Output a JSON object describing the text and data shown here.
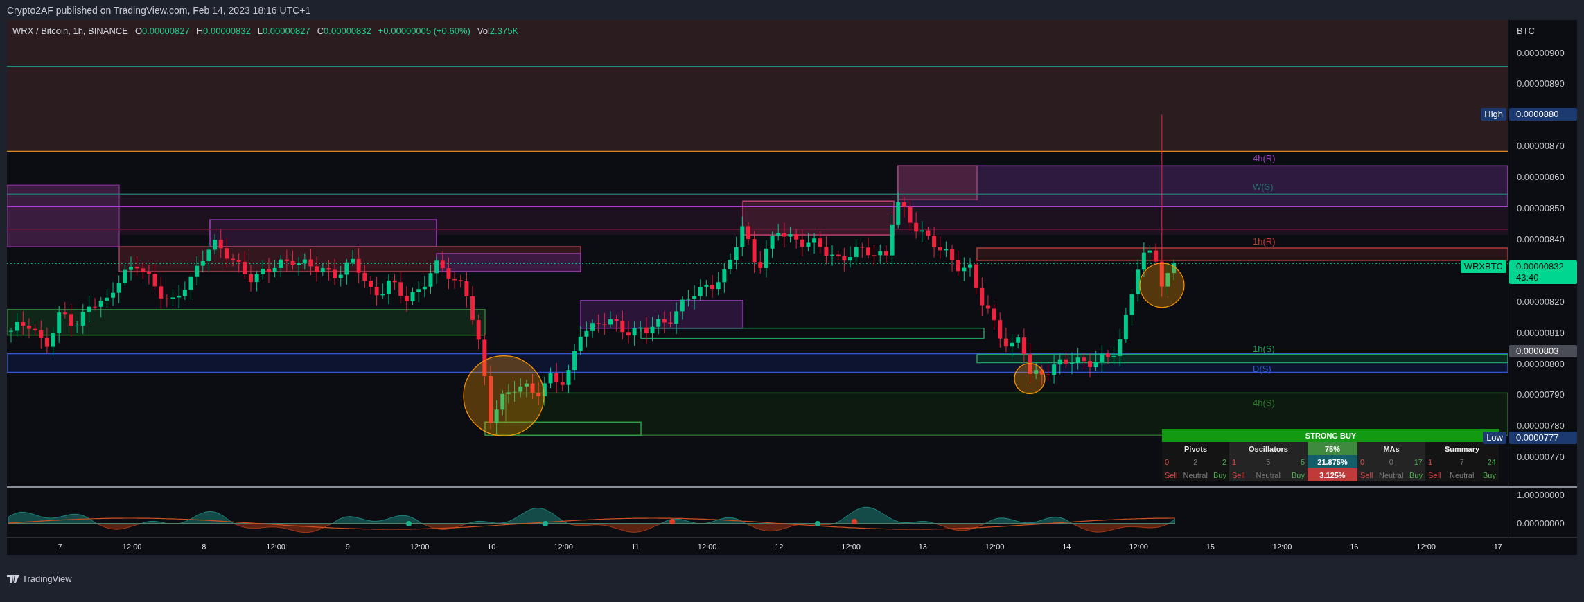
{
  "attribution": "Crypto2AF published on TradingView.com, Feb 14, 2023 18:16 UTC+1",
  "legend": {
    "symbol": "WRX / Bitcoin, 1h, BINANCE",
    "fields": [
      {
        "label": "O",
        "value": "0.00000827"
      },
      {
        "label": "H",
        "value": "0.00000832"
      },
      {
        "label": "L",
        "value": "0.00000827"
      },
      {
        "label": "C",
        "value": "0.00000832"
      }
    ],
    "change": "+0.00000005 (+0.60%)",
    "volume_label": "Vol",
    "volume": "2.375K"
  },
  "price_axis": {
    "currency": "BTC",
    "ticks": [
      "0.00000900",
      "0.00000890",
      "0.00000870",
      "0.00000860",
      "0.00000850",
      "0.00000840",
      "0.00000820",
      "0.00000810",
      "0.00000800",
      "0.00000790",
      "0.00000780",
      "0.00000770"
    ]
  },
  "price_tags": [
    {
      "kind": "high",
      "label": "High",
      "value": "0.0000880"
    },
    {
      "kind": "last",
      "label": "WRXBTC",
      "value": "0.00000832",
      "countdown": "43:40"
    },
    {
      "kind": "marker",
      "value": "0.0000803"
    },
    {
      "kind": "low",
      "label": "Low",
      "value": "0.0000777"
    }
  ],
  "levels": [
    {
      "label": "4h(R)",
      "color": "#9c3fc0"
    },
    {
      "label": "W(S)",
      "color": "#24716b"
    },
    {
      "label": "1h(R)",
      "color": "#c0403a"
    },
    {
      "label": "1h(S)",
      "color": "#1fa060"
    },
    {
      "label": "D(S)",
      "color": "#2f55d4"
    },
    {
      "label": "4h(S)",
      "color": "#2f7a2f"
    }
  ],
  "signal_table": {
    "rating": "STRONG BUY",
    "columns": [
      {
        "kind": "group",
        "title": "Pivots",
        "counts": [
          "0",
          "2",
          "2"
        ],
        "labels": [
          "Sell",
          "Neutral",
          "Buy"
        ]
      },
      {
        "kind": "group",
        "title": "Oscillators",
        "counts": [
          "1",
          "5",
          "5"
        ],
        "labels": [
          "Sell",
          "Neutral",
          "Buy"
        ]
      },
      {
        "kind": "gauge",
        "cells": [
          {
            "text": "75%",
            "color": "#3f8a3f"
          },
          {
            "text": "21.875%",
            "color": "#145e6a"
          },
          {
            "text": "3.125%",
            "color": "#c0393b"
          }
        ]
      },
      {
        "kind": "group",
        "title": "MAs",
        "counts": [
          "0",
          "0",
          "17"
        ],
        "labels": [
          "Sell",
          "Neutral",
          "Buy"
        ]
      },
      {
        "kind": "group",
        "title": "Summary",
        "counts": [
          "1",
          "7",
          "24"
        ],
        "labels": [
          "Sell",
          "Neutral",
          "Buy"
        ]
      }
    ]
  },
  "oscillator_axis": {
    "ticks": [
      "1.00000000",
      "0.00000000"
    ]
  },
  "time_axis": [
    "7",
    "12:00",
    "8",
    "12:00",
    "9",
    "12:00",
    "10",
    "12:00",
    "11",
    "12:00",
    "12",
    "12:00",
    "13",
    "12:00",
    "14",
    "12:00",
    "15",
    "12:00",
    "16",
    "12:00",
    "17"
  ],
  "footer": {
    "brand": "TradingView"
  }
}
